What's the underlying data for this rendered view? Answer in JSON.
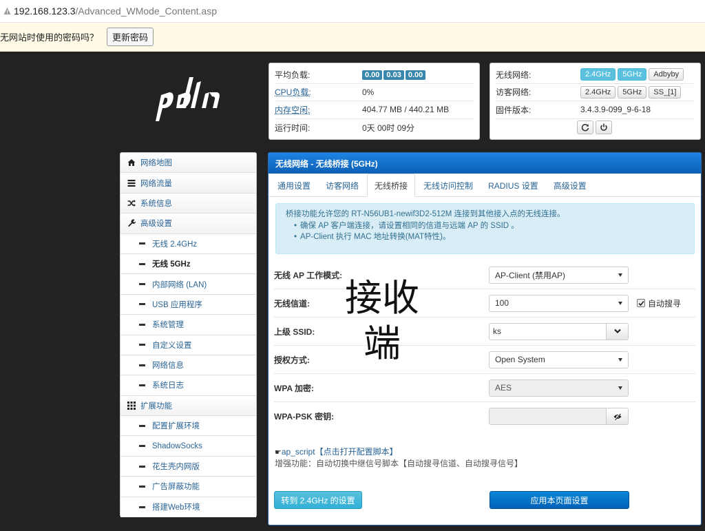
{
  "browser": {
    "host": "192.168.123.3",
    "path": "/Advanced_WMode_Content.asp"
  },
  "password_bar": {
    "question": "无网站时使用的密码吗？",
    "update_button": "更新密码"
  },
  "status": {
    "load_label": "平均负载:",
    "load_values": [
      "0.00",
      "0.03",
      "0.00"
    ],
    "cpu_label": "CPU负载:",
    "cpu_value": "0%",
    "mem_label": "内存空闲:",
    "mem_value": "404.77 MB / 440.21 MB",
    "uptime_label": "运行时间:",
    "uptime_value": "0天 00时 09分"
  },
  "quick": {
    "wireless_label": "无线网络:",
    "wireless_buttons": [
      "2.4GHz",
      "5GHz",
      "Adbyby"
    ],
    "guest_label": "访客网络:",
    "guest_buttons": [
      "2.4GHz",
      "5GHz",
      "SS_[1]"
    ],
    "firmware_label": "固件版本:",
    "firmware_value": "3.4.3.9-099_9-6-18"
  },
  "sidebar": {
    "items": [
      {
        "label": "网络地图",
        "icon": "home-icon"
      },
      {
        "label": "网络流量",
        "icon": "traffic-icon"
      },
      {
        "label": "系统信息",
        "icon": "random-icon"
      },
      {
        "label": "高级设置",
        "icon": "wrench-icon"
      },
      {
        "label": "无线 2.4GHz"
      },
      {
        "label": "无线 5GHz"
      },
      {
        "label": "内部网络 (LAN)"
      },
      {
        "label": "USB 应用程序"
      },
      {
        "label": "系统管理"
      },
      {
        "label": "自定义设置"
      },
      {
        "label": "网络信息"
      },
      {
        "label": "系统日志"
      },
      {
        "label": "扩展功能",
        "icon": "grid-icon"
      },
      {
        "label": "配置扩展环境"
      },
      {
        "label": "ShadowSocks"
      },
      {
        "label": "花生壳内网版"
      },
      {
        "label": "广告屏蔽功能"
      },
      {
        "label": "搭建Web环境"
      }
    ]
  },
  "main": {
    "title": "无线网络 - 无线桥接 (5GHz)",
    "tabs": [
      "通用设置",
      "访客网络",
      "无线桥接",
      "无线访问控制",
      "RADIUS 设置",
      "高级设置"
    ],
    "info_line": "桥接功能允许您的 RT-N56UB1-newif3D2-512M 连接到其他接入点的无线连接。",
    "info_bullets": [
      "确保 AP 客户端连接，请设置相同的信道与远端 AP 的 SSID 。",
      "AP-Client 执行 MAC 地址转换(MAT特性)。"
    ],
    "fields": {
      "mode_label": "无线 AP 工作模式:",
      "mode_value": "AP-Client (禁用AP)",
      "channel_label": "无线信道:",
      "channel_value": "100",
      "auto_search_label": "自动搜寻",
      "ssid_label": "上级 SSID:",
      "ssid_value": "ks",
      "auth_label": "授权方式:",
      "auth_value": "Open System",
      "enc_label": "WPA 加密:",
      "enc_value": "AES",
      "psk_label": "WPA-PSK 密钥:",
      "psk_value": ""
    },
    "overlay_text": "接收端",
    "script_link": "ap_script【点击打开配置脚本】",
    "script_desc": "增强功能：自动切换中继信号脚本【自动搜寻信道、自动搜寻信号】",
    "btn_goto_24": "转到 2.4GHz 的设置",
    "btn_apply": "应用本页面设置"
  }
}
